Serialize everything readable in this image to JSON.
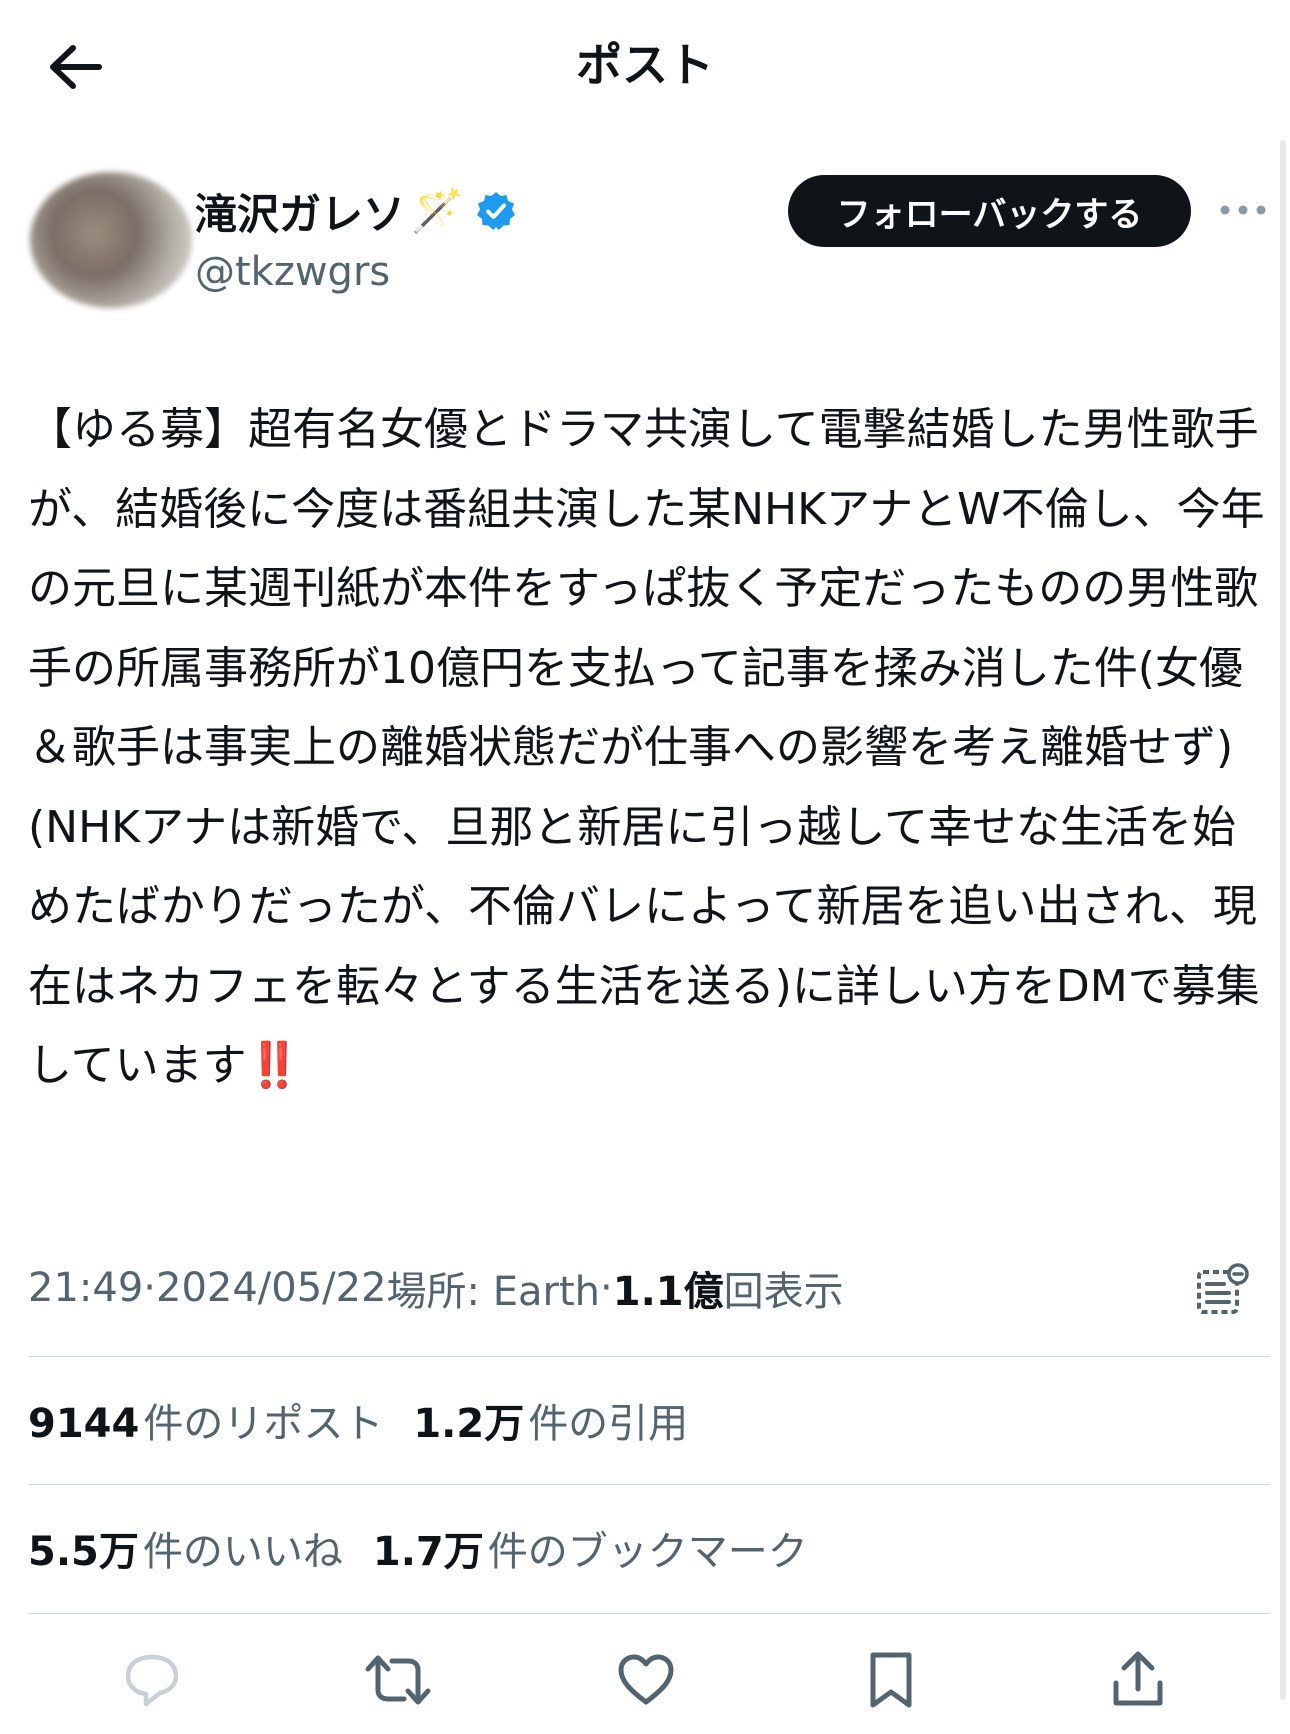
{
  "header": {
    "title": "ポスト",
    "back_icon": "arrow-left-icon"
  },
  "author": {
    "display_name": "滝沢ガレソ",
    "name_emoji": "🪄",
    "handle": "@tkzwgrs",
    "verified": true,
    "verified_color": "#1d9bf0"
  },
  "follow_button": {
    "label": "フォローバックする"
  },
  "tweet": {
    "text": "【ゆる募】超有名女優とドラマ共演して電撃結婚した男性歌手が、結婚後に今度は番組共演した某NHKアナとW不倫し、今年の元旦に某週刊紙が本件をすっぱ抜く予定だったものの男性歌手の所属事務所が10億円を支払って記事を揉み消した件(女優＆歌手は事実上の離婚状態だが仕事への影響を考え離婚せず)\n(NHKアナは新婚で、旦那と新居に引っ越して幸せな生活を始めたばかりだったが、不倫バレによって新居を追い出され、現在はネカフェを転々とする生活を送る)に詳しい方をDMで募集しています",
    "emoji": "‼️"
  },
  "meta": {
    "time": "21:49",
    "sep1": " · ",
    "date": "2024/05/22",
    "location": " 場所: Earth",
    "sep2": " · ",
    "views_num": "1.1億",
    "views_label": "回表示"
  },
  "stats": {
    "reposts_num": "9144",
    "reposts_label": "件のリポスト",
    "quotes_num": "1.2万",
    "quotes_label": "件の引用",
    "likes_num": "5.5万",
    "likes_label": "件のいいね",
    "bookmarks_num": "1.7万",
    "bookmarks_label": "件のブックマーク"
  },
  "actions": [
    "reply-icon",
    "repost-icon",
    "like-icon",
    "bookmark-icon",
    "share-icon"
  ],
  "colors": {
    "text": "#0f1419",
    "secondary": "#536471",
    "divider": "#cfd9de",
    "accent": "#1d9bf0",
    "reply_icon": "#c7d0d6"
  }
}
